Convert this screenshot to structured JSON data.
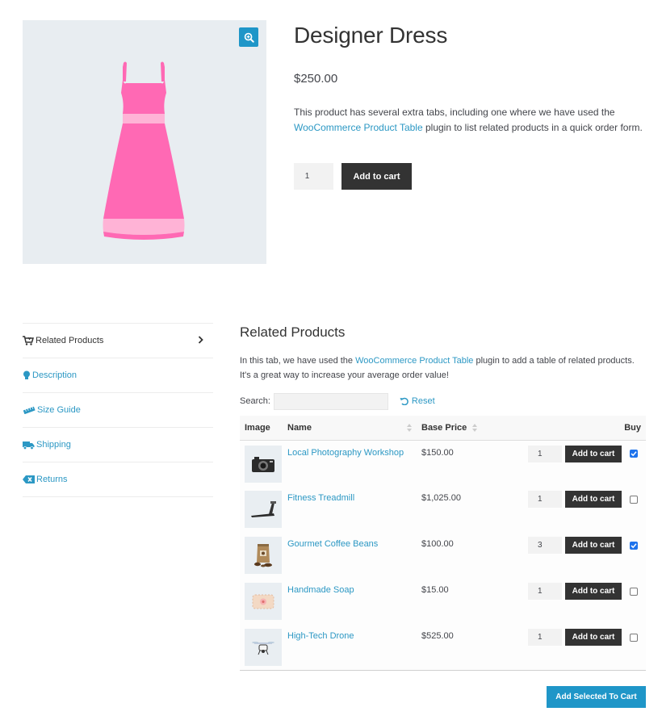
{
  "product": {
    "title": "Designer Dress",
    "price": "$250.00",
    "description_before": "This product has several extra tabs, including one where we have used the ",
    "description_link": "WooCommerce Product Table",
    "description_after": " plugin to list related products in a quick order form.",
    "quantity": "1",
    "add_to_cart_label": "Add to cart",
    "image_icon": "dress-image",
    "zoom_icon": "zoom-in-icon"
  },
  "colors": {
    "accent": "#1f96c8",
    "link": "#2c98c4",
    "dark_button": "#333333",
    "dress_pink": "#ff69b4",
    "dress_light_pink": "#ffb3d6",
    "checkbox_checked": "#1e73ec"
  },
  "tabs": [
    {
      "label": "Related Products",
      "icon": "cart-icon",
      "active": true
    },
    {
      "label": "Description",
      "icon": "lightbulb-icon",
      "active": false
    },
    {
      "label": "Size Guide",
      "icon": "ruler-icon",
      "active": false
    },
    {
      "label": "Shipping",
      "icon": "truck-icon",
      "active": false
    },
    {
      "label": "Returns",
      "icon": "backspace-icon",
      "active": false
    }
  ],
  "panel": {
    "title": "Related Products",
    "desc_before": "In this tab, we have used the ",
    "desc_link": "WooCommerce Product Table",
    "desc_after": " plugin to add a table of related products. It's a great way to increase your average order value!",
    "search_label": "Search:",
    "search_value": "",
    "reset_label": "Reset"
  },
  "table": {
    "headers": {
      "image": "Image",
      "name": "Name",
      "base_price": "Base Price",
      "buy": "Buy"
    },
    "rows": [
      {
        "name": "Local Photography Workshop",
        "price": "$150.00",
        "qty": "1",
        "button": "Add to cart",
        "checked": true,
        "thumb_icon": "camera-icon"
      },
      {
        "name": "Fitness Treadmill",
        "price": "$1,025.00",
        "qty": "1",
        "button": "Add to cart",
        "checked": false,
        "thumb_icon": "treadmill-icon"
      },
      {
        "name": "Gourmet Coffee Beans",
        "price": "$100.00",
        "qty": "3",
        "button": "Add to cart",
        "checked": true,
        "thumb_icon": "coffee-bag-icon"
      },
      {
        "name": "Handmade Soap",
        "price": "$15.00",
        "qty": "1",
        "button": "Add to cart",
        "checked": false,
        "thumb_icon": "soap-icon"
      },
      {
        "name": "High-Tech Drone",
        "price": "$525.00",
        "qty": "1",
        "button": "Add to cart",
        "checked": false,
        "thumb_icon": "drone-icon"
      }
    ],
    "add_selected_label": "Add Selected To Cart"
  }
}
